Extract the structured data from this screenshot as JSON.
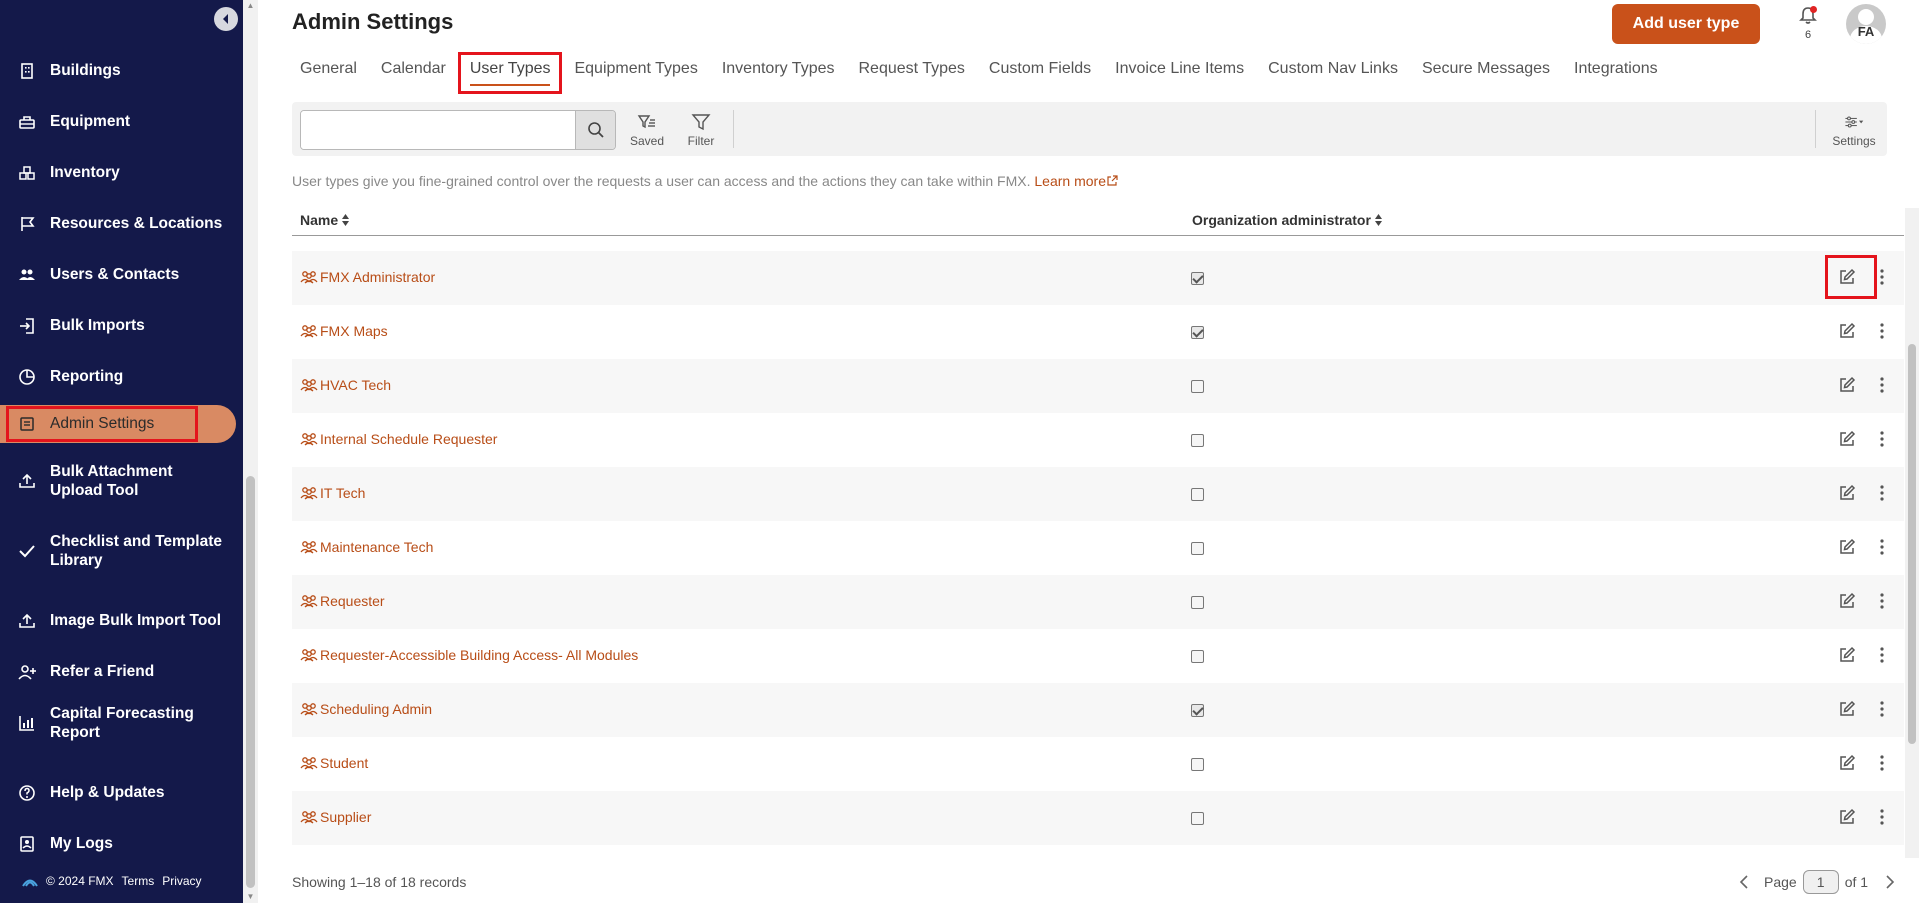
{
  "sidebar": {
    "items": [
      {
        "label": "Buildings",
        "icon": "building-icon"
      },
      {
        "label": "Equipment",
        "icon": "equipment-icon"
      },
      {
        "label": "Inventory",
        "icon": "inventory-icon"
      },
      {
        "label": "Resources & Locations",
        "icon": "flag-icon"
      },
      {
        "label": "Users & Contacts",
        "icon": "users-icon"
      },
      {
        "label": "Bulk Imports",
        "icon": "import-icon"
      },
      {
        "label": "Reporting",
        "icon": "pie-chart-icon"
      },
      {
        "label": "Admin Settings",
        "icon": "settings-doc-icon"
      },
      {
        "label": "Bulk Attachment\nUpload Tool",
        "icon": "upload-icon"
      },
      {
        "label": "Checklist and Template\nLibrary",
        "icon": "check-icon"
      },
      {
        "label": "Image Bulk Import Tool",
        "icon": "upload-icon"
      },
      {
        "label": "Refer a Friend",
        "icon": "add-user-icon"
      },
      {
        "label": "Capital Forecasting\nReport",
        "icon": "bar-chart-icon"
      },
      {
        "label": "Help & Updates",
        "icon": "help-icon"
      },
      {
        "label": "My Logs",
        "icon": "log-icon"
      }
    ],
    "footer": {
      "copyright": "© 2024 FMX",
      "terms": "Terms",
      "privacy": "Privacy"
    }
  },
  "header": {
    "title": "Admin Settings",
    "add_button": "Add user type",
    "notification_count": "6",
    "avatar_initials": "FA"
  },
  "tabs": [
    "General",
    "Calendar",
    "User Types",
    "Equipment Types",
    "Inventory Types",
    "Request Types",
    "Custom Fields",
    "Invoice Line Items",
    "Custom Nav Links",
    "Secure Messages",
    "Integrations"
  ],
  "toolbar": {
    "search_placeholder": "",
    "saved_label": "Saved",
    "filter_label": "Filter",
    "settings_label": "Settings"
  },
  "description": {
    "text": "User types give you fine-grained control over the requests a user can access and the actions they can take within FMX.",
    "learn_more": "Learn more"
  },
  "table": {
    "columns": {
      "name": "Name",
      "org_admin": "Organization administrator"
    },
    "rows": [
      {
        "name": "FMX Administrator",
        "org_admin": true
      },
      {
        "name": "FMX Maps",
        "org_admin": true
      },
      {
        "name": "HVAC Tech",
        "org_admin": false
      },
      {
        "name": "Internal Schedule Requester",
        "org_admin": false
      },
      {
        "name": "IT Tech",
        "org_admin": false
      },
      {
        "name": "Maintenance Tech",
        "org_admin": false
      },
      {
        "name": "Requester",
        "org_admin": false
      },
      {
        "name": "Requester-Accessible Building Access- All Modules",
        "org_admin": false
      },
      {
        "name": "Scheduling Admin",
        "org_admin": true
      },
      {
        "name": "Student",
        "org_admin": false
      },
      {
        "name": "Supplier",
        "org_admin": false
      }
    ]
  },
  "footer": {
    "records": "Showing 1–18 of 18 records",
    "page_label": "Page",
    "page_value": "1",
    "of_label": "of 1"
  },
  "colors": {
    "sidebar_bg": "#14194a",
    "accent": "#c9511a",
    "link": "#b84d17",
    "active_nav": "#d98a63",
    "highlight": "#e4141c"
  }
}
